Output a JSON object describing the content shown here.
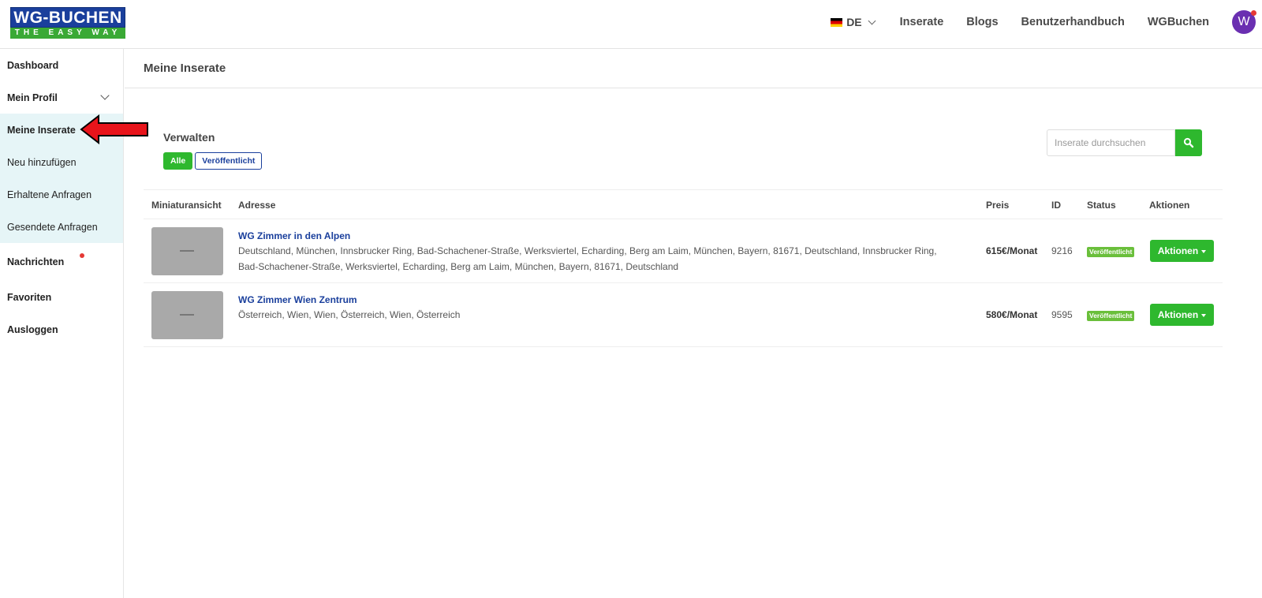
{
  "logo": {
    "line1": "WG-BUCHEN",
    "line2": "THE EASY WAY"
  },
  "header": {
    "language": "DE",
    "nav": [
      "Inserate",
      "Blogs",
      "Benutzerhandbuch",
      "WGBuchen"
    ],
    "avatar_letter": "W"
  },
  "sidebar": {
    "items": [
      {
        "label": "Dashboard"
      },
      {
        "label": "Mein Profil"
      },
      {
        "label": "Meine Inserate"
      },
      {
        "label": "Neu hinzufügen"
      },
      {
        "label": "Erhaltene Anfragen"
      },
      {
        "label": "Gesendete Anfragen"
      },
      {
        "label": "Nachrichten"
      },
      {
        "label": "Favoriten"
      },
      {
        "label": "Ausloggen"
      }
    ]
  },
  "page": {
    "title": "Meine Inserate",
    "manage_label": "Verwalten",
    "filter_all": "Alle",
    "filter_published": "Veröffentlicht",
    "search_placeholder": "Inserate durchsuchen"
  },
  "table": {
    "columns": [
      "Miniaturansicht",
      "Adresse",
      "Preis",
      "ID",
      "Status",
      "Aktionen"
    ],
    "rows": [
      {
        "title": "WG Zimmer in den Alpen",
        "address": "Deutschland, München, Innsbrucker Ring, Bad-Schachener-Straße, Werksviertel, Echarding, Berg am Laim, München, Bayern, 81671, Deutschland, Innsbrucker Ring, Bad-Schachener-Straße, Werksviertel, Echarding, Berg am Laim, München, Bayern, 81671, Deutschland",
        "price": "615€/Monat",
        "id": "9216",
        "status": "Veröffentlicht",
        "action": "Aktionen"
      },
      {
        "title": "WG Zimmer Wien Zentrum",
        "address": "Österreich, Wien, Wien, Österreich, Wien, Österreich",
        "price": "580€/Monat",
        "id": "9595",
        "status": "Veröffentlicht",
        "action": "Aktionen"
      }
    ]
  },
  "colors": {
    "brand_blue": "#1a3f9c",
    "brand_green": "#2eb82e",
    "sidebar_active_bg": "#e6f5f7",
    "status_badge": "#6abf3b",
    "annotation_arrow": "#e8141b"
  }
}
